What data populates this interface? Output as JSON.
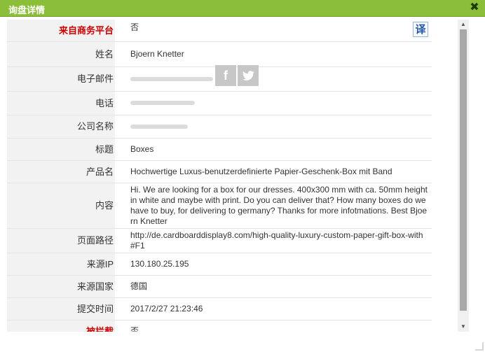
{
  "dialog": {
    "title": "询盘详情",
    "close_glyph": "✖"
  },
  "translate_button": "译",
  "social": {
    "facebook": "f",
    "twitter": "🐦"
  },
  "rows": [
    {
      "label": "来自商务平台",
      "value": "否"
    },
    {
      "label": "姓名",
      "value": "Bjoern Knetter"
    },
    {
      "label": "电子邮件",
      "value": ""
    },
    {
      "label": "电话",
      "value": ""
    },
    {
      "label": "公司名称",
      "value": ""
    },
    {
      "label": "标题",
      "value": "Boxes"
    },
    {
      "label": "产品名",
      "value": "Hochwertige Luxus-benutzerdefinierte Papier-Geschenk-Box mit Band"
    },
    {
      "label": "内容",
      "value": "Hi. We are looking for a box for our dresses. 400x300 mm with ca. 50mm height in white and maybe with print. Do you can deliver that? How many boxes do we have to buy, for delivering to germany? Thanks for more infotmations. Best Bjoern Knetter"
    },
    {
      "label": "页面路径",
      "value": "http://de.cardboarddisplay8.com/high-quality-luxury-custom-paper-gift-box-with#F1"
    },
    {
      "label": "来源IP",
      "value": "130.180.25.195"
    },
    {
      "label": "来源国家",
      "value": "德国"
    },
    {
      "label": "提交时间",
      "value": "2017/2/27 21:23:46"
    },
    {
      "label": "被拦截",
      "value": "否"
    }
  ],
  "scrollbar": {
    "up": "▲",
    "down": "▼"
  }
}
